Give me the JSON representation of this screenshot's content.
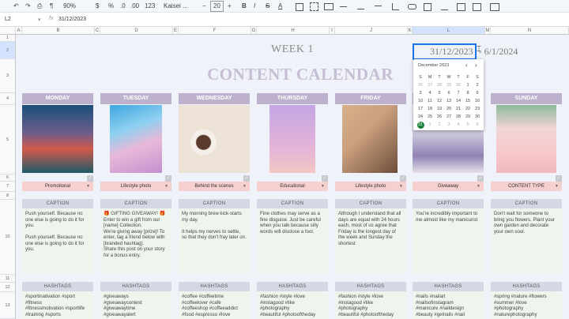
{
  "toolbar": {
    "undo": "↶",
    "redo": "↷",
    "print": "⎙",
    "paint": "¶",
    "zoom": "90%",
    "currency": "$",
    "percent": "%",
    "dec_dec": ".0",
    "dec_inc": ".00",
    "number_format": "123",
    "font": "Kaisei ...",
    "font_size_minus": "−",
    "font_size": "20",
    "font_size_plus": "+",
    "bold": "B",
    "italic": "I",
    "strike": "S",
    "textcolor": "A"
  },
  "formula_bar": {
    "cell_ref": "L2",
    "fx": "fx",
    "value": "31/12/2023"
  },
  "columns": [
    "A",
    "B",
    "C",
    "D",
    "E",
    "F",
    "G",
    "H",
    "I",
    "J",
    "K",
    "L",
    "M",
    "N"
  ],
  "rows": [
    "1",
    "2",
    "3",
    "4",
    "5",
    "6",
    "7",
    "8",
    "10",
    "11",
    "12",
    "13"
  ],
  "header": {
    "week": "WEEK 1",
    "title": "CONTENT CALENDAR",
    "date_start": "31/12/2023",
    "date_sep": " - ",
    "date_end": "6/1/2024"
  },
  "datepicker": {
    "month": "December 2023",
    "prev": "‹",
    "next": "›",
    "weekdays": [
      "S",
      "M",
      "T",
      "W",
      "T",
      "F",
      "S"
    ],
    "weeks": [
      [
        "26",
        "27",
        "28",
        "29",
        "30",
        "1",
        "2"
      ],
      [
        "3",
        "4",
        "5",
        "6",
        "7",
        "8",
        "9"
      ],
      [
        "10",
        "11",
        "12",
        "13",
        "14",
        "15",
        "16"
      ],
      [
        "17",
        "18",
        "19",
        "20",
        "21",
        "22",
        "23"
      ],
      [
        "24",
        "25",
        "26",
        "27",
        "28",
        "29",
        "30"
      ],
      [
        "31",
        "1",
        "2",
        "3",
        "4",
        "5",
        "6"
      ]
    ],
    "selected": "31",
    "accent": "#188038"
  },
  "days": [
    {
      "name": "MONDAY",
      "type": "Promotional",
      "caption": "Push yourself. Because no one else is going to do it for you.\n\nPush yourself. Because no one else is going to do it for you.",
      "hashtags": "#sportinativation #sport\n#fitness\n#fitnessmotivation #sportlife\n#training #sports"
    },
    {
      "name": "TUESDAY",
      "type": "Lifestyle photo",
      "caption": "🎁 GIFTING GIVEAWAY! 🎁\nEnter to win a gift from our [name] Collection.\nWe're giving away [prize]! To enter, tag a friend below with [branded hashtag].\nShare this post on your story for a bonus entry.",
      "hashtags": "#giveaways\n#giveawaycontest\n#giveawaytime\n#giveawayalert"
    },
    {
      "name": "WEDNESDAY",
      "type": "Behind the scenes",
      "caption": "My morning brew kick-starts my day.\n\nIt helps my nerves to settle, so that they don't fray later on.",
      "hashtags": "#coffee #coffeetime\n#coffeelover #cafe\n#coffeeshop #coffeeaddict\n#food #espresso #love"
    },
    {
      "name": "THURSDAY",
      "type": "Educational",
      "caption": "Fine clothes may serve as a fine disguise. Just be careful when you talk because silly words will disclose a fool.",
      "hashtags": "#fashion #style #love\n#instagood #like\n#photography\n#beautiful #photooftheday"
    },
    {
      "name": "FRIDAY",
      "type": "Lifestyle photo",
      "caption": "Although I understand that all days are equal with 24 hours each, most of us agree that Friday is the longest day of the week and Sunday the shortest",
      "hashtags": "#fashion #style #love\n#instagood #like\n#photography\n#beautiful #photooftheday"
    },
    {
      "name": "SATURDAY",
      "type": "Giveaway",
      "caption": "You're incredibly important to me almost like my manicurist",
      "hashtags": "#nails #nailart\n#nailsofinstagram\n#manicure #naildesign\n#beauty #gelnails #nail"
    },
    {
      "name": "SUNDAY",
      "type": "CONTENT TYPE",
      "caption": "Don't wait for someone to bring you flowers. Plant your own garden and decorate your own soul.",
      "hashtags": "#spring #nature #flowers\n#summer #love\n#photography\n#naturephotography"
    }
  ],
  "labels": {
    "caption": "CAPTION",
    "hashtags": "HASHTAGS"
  },
  "colors": {
    "day_header": "#bdb1cd",
    "content_type": "#f6cfcf",
    "text_area": "#eef5ec",
    "background": "#eff2f8"
  }
}
